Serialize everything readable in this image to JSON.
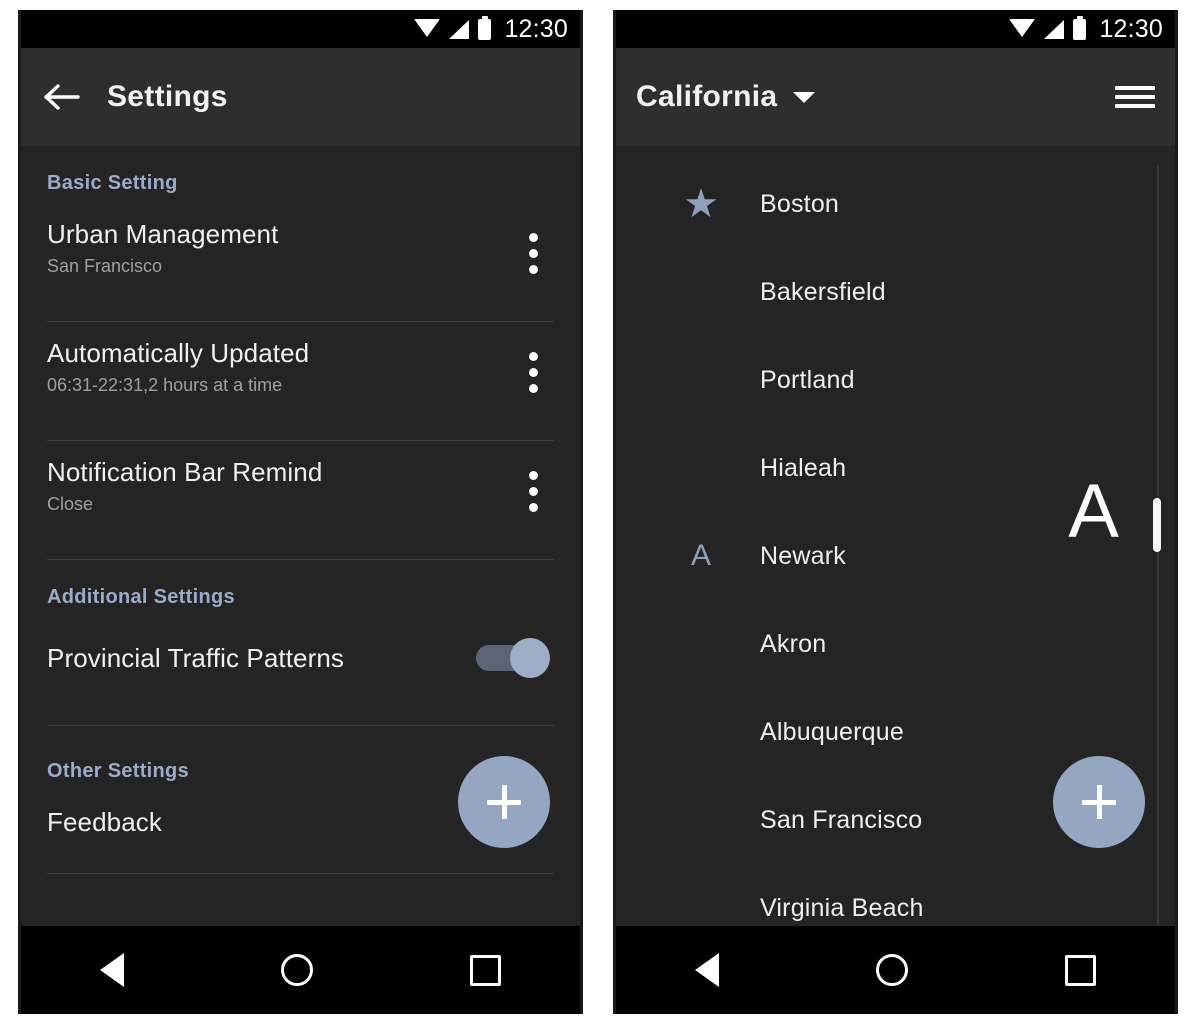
{
  "status_bar": {
    "time": "12:30",
    "icons": [
      "wifi-icon",
      "signal-icon",
      "battery-icon"
    ]
  },
  "colors": {
    "accent": "#94a6c2",
    "section_header": "#9aadc8",
    "background": "#242424",
    "appbar": "#2e2e2e",
    "navbar": "#000000",
    "divider": "#3b3b3b",
    "toggle_track": "#5b6474",
    "toggle_thumb": "#9cadc7"
  },
  "settings_screen": {
    "appbar": {
      "back_label": "←",
      "title": "Settings"
    },
    "sections": [
      {
        "header": "Basic Setting",
        "items": [
          {
            "title": "Urban Management",
            "subtitle": "San Francisco",
            "menu": "overflow-menu"
          },
          {
            "title": "Automatically Updated",
            "subtitle": "06:31-22:31,2 hours at a time",
            "menu": "overflow-menu"
          },
          {
            "title": "Notification Bar Remind",
            "subtitle": "Close",
            "menu": "overflow-menu"
          }
        ]
      },
      {
        "header": "Additional Settings",
        "items": [
          {
            "title": "Provincial Traffic Patterns",
            "control": "toggle",
            "toggle_on": true
          }
        ]
      },
      {
        "header": "Other Settings",
        "items": [
          {
            "title": "Feedback"
          }
        ]
      }
    ],
    "fab": {
      "icon": "plus-icon",
      "label": "+"
    }
  },
  "city_screen": {
    "appbar": {
      "title": "California",
      "dropdown": "chevron-down-icon",
      "menu": "hamburger-menu-icon"
    },
    "fastscroll": {
      "letter": "A"
    },
    "rows": [
      {
        "index": "★",
        "index_type": "star",
        "name": "Boston"
      },
      {
        "index": "",
        "index_type": "none",
        "name": "Bakersfield"
      },
      {
        "index": "",
        "index_type": "none",
        "name": "Portland"
      },
      {
        "index": "",
        "index_type": "none",
        "name": "Hialeah"
      },
      {
        "index": "A",
        "index_type": "letter",
        "name": "Newark"
      },
      {
        "index": "",
        "index_type": "none",
        "name": "Akron"
      },
      {
        "index": "",
        "index_type": "none",
        "name": "Albuquerque"
      },
      {
        "index": "",
        "index_type": "none",
        "name": "San Francisco"
      },
      {
        "index": "",
        "index_type": "none",
        "name": "Virginia Beach"
      }
    ],
    "fab": {
      "icon": "plus-icon",
      "label": "+"
    }
  },
  "navbar": {
    "back": "back-triangle-icon",
    "home": "home-circle-icon",
    "recents": "recents-square-icon"
  }
}
